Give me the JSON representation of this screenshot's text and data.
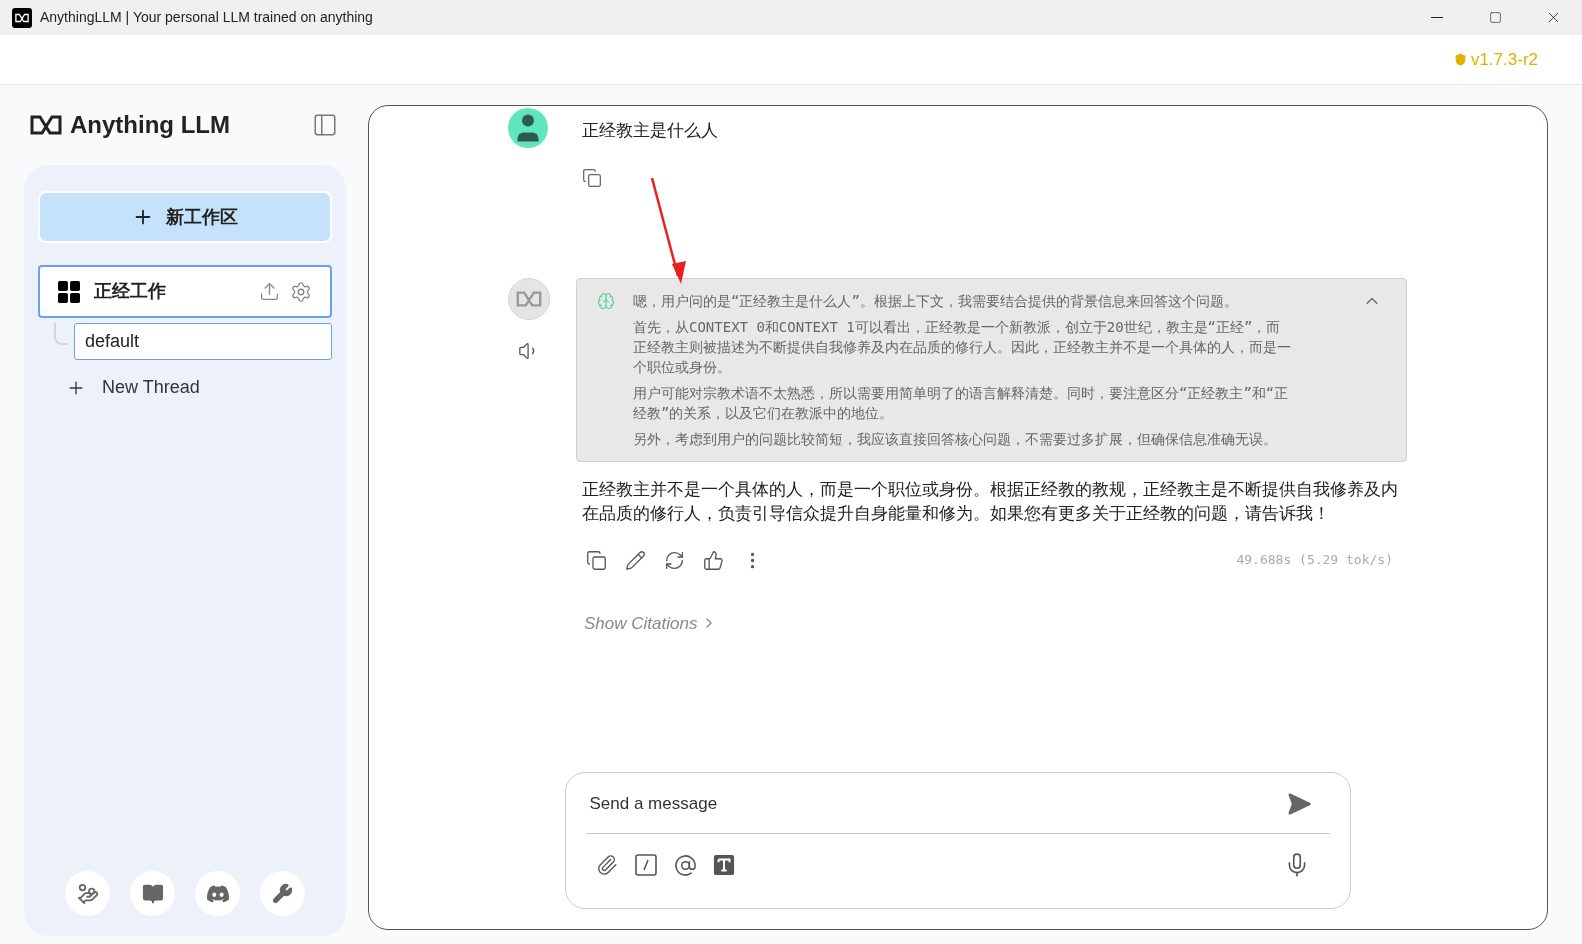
{
  "window": {
    "title": "AnythingLLM | Your personal LLM trained on anything"
  },
  "version": "v1.7.3-r2",
  "sidebar": {
    "logo": "Anything LLM",
    "new_workspace": "新工作区",
    "workspaces": [
      {
        "name": "正经工作",
        "selected": true,
        "threads": [
          {
            "name": "default",
            "selected": true
          }
        ]
      }
    ],
    "new_thread": "New Thread"
  },
  "chat": {
    "user_message": "正经教主是什么人",
    "thinking": {
      "expanded": true,
      "paragraphs": [
        "嗯，用户问的是“正经教主是什么人”。根据上下文，我需要结合提供的背景信息来回答这个问题。",
        "首先，从CONTEXT 0和CONTEXT 1可以看出，正经教是一个新教派，创立于20世纪，教主是“正经”，而正经教主则被描述为不断提供自我修养及内在品质的修行人。因此，正经教主并不是一个具体的人，而是一个职位或身份。",
        "用户可能对宗教术语不太熟悉，所以需要用简单明了的语言解释清楚。同时，要注意区分“正经教主”和“正经教”的关系，以及它们在教派中的地位。",
        "另外，考虑到用户的问题比较简短，我应该直接回答核心问题，不需要过多扩展，但确保信息准确无误。"
      ]
    },
    "answer": "正经教主并不是一个具体的人，而是一个职位或身份。根据正经教的教规，正经教主是不断提供自我修养及内在品质的修行人，负责引导信众提升自身能量和修为。如果您有更多关于正经教的问题，请告诉我！",
    "stats": "49.688s (5.29 tok/s)",
    "citations": "Show Citations",
    "input": {
      "placeholder": "Send a message"
    }
  }
}
